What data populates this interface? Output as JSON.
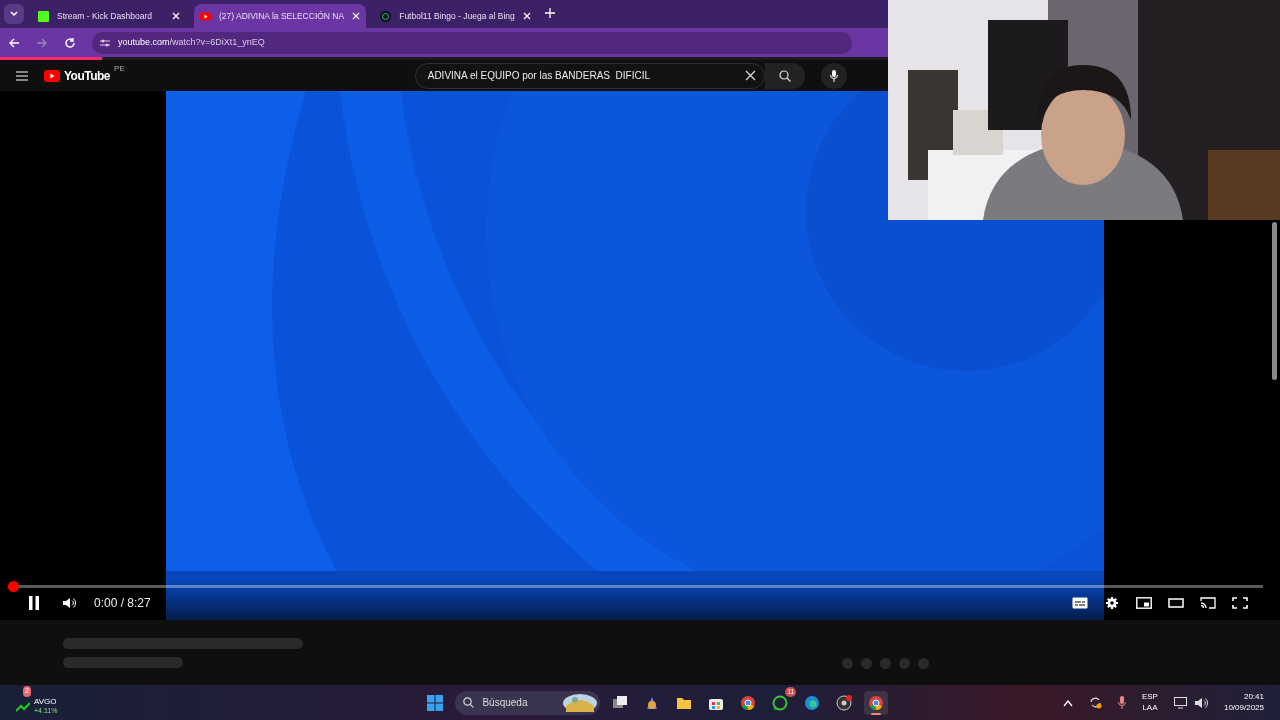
{
  "browser": {
    "tabs": [
      {
        "title": "Stream - Kick Dashboard",
        "kind": "kick",
        "selected": false
      },
      {
        "title": "(27) ADIVINA la SELECCIÓN NA",
        "kind": "youtube",
        "selected": true
      },
      {
        "title": "Futbol11 Bingo - Juega al Bing",
        "kind": "futbol",
        "selected": false
      }
    ],
    "address": {
      "host": "youtube.com",
      "path": "/watch?v=6DiXt1_ynEQ"
    },
    "load": {
      "level": 0.08
    }
  },
  "youtube": {
    "logo": "YouTube",
    "region": "PE",
    "search": {
      "value": "ADIVINA el EQUIPO por las BANDERAS  DIFICIL"
    },
    "player": {
      "playing": true,
      "progress": {
        "level": 0
      },
      "time": "0:00 / 8:27"
    }
  },
  "taskbar": {
    "stock": {
      "badge": "2",
      "symbol": "AVGO",
      "change": "+4.11%"
    },
    "search": {
      "placeholder": "Búsqueda"
    },
    "apps": [
      {
        "kind": "taskview"
      },
      {
        "kind": "copilot"
      },
      {
        "kind": "folder"
      },
      {
        "kind": "store"
      },
      {
        "kind": "chrome"
      },
      {
        "kind": "whatsapp",
        "badge": "11"
      },
      {
        "kind": "edge"
      },
      {
        "kind": "obs"
      },
      {
        "kind": "chrome",
        "selected": true
      }
    ],
    "language": [
      "ESP",
      "LAA"
    ],
    "time": "20:41",
    "date": "10/09/2025"
  }
}
